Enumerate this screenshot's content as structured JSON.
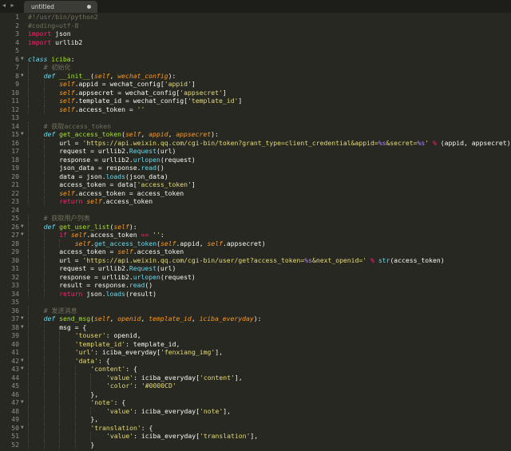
{
  "tabbar": {
    "nav_glyph": "◂ ▸",
    "tab_title": "untitled"
  },
  "lines": [
    {
      "n": "1",
      "fold": "",
      "indent": 0,
      "tokens": [
        [
          "cmt",
          "#!/usr/bin/python2"
        ]
      ]
    },
    {
      "n": "2",
      "fold": "",
      "indent": 0,
      "tokens": [
        [
          "cmt",
          "#coding=utf-8"
        ]
      ]
    },
    {
      "n": "3",
      "fold": "",
      "indent": 0,
      "tokens": [
        [
          "kw",
          "import"
        ],
        [
          "txt",
          " json"
        ]
      ]
    },
    {
      "n": "4",
      "fold": "",
      "indent": 0,
      "tokens": [
        [
          "kw",
          "import"
        ],
        [
          "txt",
          " urllib2"
        ]
      ]
    },
    {
      "n": "5",
      "fold": "",
      "indent": 0,
      "tokens": []
    },
    {
      "n": "6",
      "fold": "▼",
      "indent": 0,
      "tokens": [
        [
          "def",
          "class"
        ],
        [
          "txt",
          " "
        ],
        [
          "fn",
          "iciba"
        ],
        [
          "txt",
          ":"
        ]
      ]
    },
    {
      "n": "7",
      "fold": "",
      "indent": 1,
      "tokens": [
        [
          "cmt",
          "# 初始化"
        ]
      ]
    },
    {
      "n": "8",
      "fold": "▼",
      "indent": 1,
      "tokens": [
        [
          "def",
          "def"
        ],
        [
          "txt",
          " "
        ],
        [
          "fn",
          "__init__"
        ],
        [
          "txt",
          "("
        ],
        [
          "self",
          "self"
        ],
        [
          "txt",
          ", "
        ],
        [
          "self",
          "wechat_config"
        ],
        [
          "txt",
          "):"
        ]
      ]
    },
    {
      "n": "9",
      "fold": "",
      "indent": 2,
      "tokens": [
        [
          "self",
          "self"
        ],
        [
          "txt",
          ".appid = wechat_config["
        ],
        [
          "str",
          "'appid'"
        ],
        [
          "txt",
          "]"
        ]
      ]
    },
    {
      "n": "10",
      "fold": "",
      "indent": 2,
      "tokens": [
        [
          "self",
          "self"
        ],
        [
          "txt",
          ".appsecret = wechat_config["
        ],
        [
          "str",
          "'appsecret'"
        ],
        [
          "txt",
          "]"
        ]
      ]
    },
    {
      "n": "11",
      "fold": "",
      "indent": 2,
      "tokens": [
        [
          "self",
          "self"
        ],
        [
          "txt",
          ".template_id = wechat_config["
        ],
        [
          "str",
          "'template_id'"
        ],
        [
          "txt",
          "]"
        ]
      ]
    },
    {
      "n": "12",
      "fold": "",
      "indent": 2,
      "tokens": [
        [
          "self",
          "self"
        ],
        [
          "txt",
          ".access_token = "
        ],
        [
          "str",
          "''"
        ]
      ]
    },
    {
      "n": "13",
      "fold": "",
      "indent": 0,
      "tokens": []
    },
    {
      "n": "14",
      "fold": "",
      "indent": 1,
      "tokens": [
        [
          "cmt",
          "# 获取access_token"
        ]
      ]
    },
    {
      "n": "15",
      "fold": "▼",
      "indent": 1,
      "tokens": [
        [
          "def",
          "def"
        ],
        [
          "txt",
          " "
        ],
        [
          "fn",
          "get_access_token"
        ],
        [
          "txt",
          "("
        ],
        [
          "self",
          "self"
        ],
        [
          "txt",
          ", "
        ],
        [
          "self",
          "appid"
        ],
        [
          "txt",
          ", "
        ],
        [
          "self",
          "appsecret"
        ],
        [
          "txt",
          "):"
        ]
      ]
    },
    {
      "n": "16",
      "fold": "",
      "indent": 2,
      "tokens": [
        [
          "txt",
          "url = "
        ],
        [
          "str",
          "'https://api.weixin.qq.com/cgi-bin/token?grant_type=client_credential&appid="
        ],
        [
          "fmt",
          "%s"
        ],
        [
          "str",
          "&secret="
        ],
        [
          "fmt",
          "%s"
        ],
        [
          "str",
          "'"
        ],
        [
          "txt",
          " "
        ],
        [
          "kw",
          "%"
        ],
        [
          "txt",
          " (appid, appsecret)"
        ]
      ]
    },
    {
      "n": "17",
      "fold": "",
      "indent": 2,
      "tokens": [
        [
          "txt",
          "request = urllib2."
        ],
        [
          "bi",
          "Request"
        ],
        [
          "txt",
          "(url)"
        ]
      ]
    },
    {
      "n": "18",
      "fold": "",
      "indent": 2,
      "tokens": [
        [
          "txt",
          "response = urllib2."
        ],
        [
          "bi",
          "urlopen"
        ],
        [
          "txt",
          "(request)"
        ]
      ]
    },
    {
      "n": "19",
      "fold": "",
      "indent": 2,
      "tokens": [
        [
          "txt",
          "json_data = response."
        ],
        [
          "bi",
          "read"
        ],
        [
          "txt",
          "()"
        ]
      ]
    },
    {
      "n": "20",
      "fold": "",
      "indent": 2,
      "tokens": [
        [
          "txt",
          "data = json."
        ],
        [
          "bi",
          "loads"
        ],
        [
          "txt",
          "(json_data)"
        ]
      ]
    },
    {
      "n": "21",
      "fold": "",
      "indent": 2,
      "tokens": [
        [
          "txt",
          "access_token = data["
        ],
        [
          "str",
          "'access_token'"
        ],
        [
          "txt",
          "]"
        ]
      ]
    },
    {
      "n": "22",
      "fold": "",
      "indent": 2,
      "tokens": [
        [
          "self",
          "self"
        ],
        [
          "txt",
          ".access_token = access_token"
        ]
      ]
    },
    {
      "n": "23",
      "fold": "",
      "indent": 2,
      "tokens": [
        [
          "kw",
          "return"
        ],
        [
          "txt",
          " "
        ],
        [
          "self",
          "self"
        ],
        [
          "txt",
          ".access_token"
        ]
      ]
    },
    {
      "n": "24",
      "fold": "",
      "indent": 0,
      "tokens": []
    },
    {
      "n": "25",
      "fold": "",
      "indent": 1,
      "tokens": [
        [
          "cmt",
          "# 获取用户列表"
        ]
      ]
    },
    {
      "n": "26",
      "fold": "▼",
      "indent": 1,
      "tokens": [
        [
          "def",
          "def"
        ],
        [
          "txt",
          " "
        ],
        [
          "fn",
          "get_user_list"
        ],
        [
          "txt",
          "("
        ],
        [
          "self",
          "self"
        ],
        [
          "txt",
          "):"
        ]
      ]
    },
    {
      "n": "27",
      "fold": "▼",
      "indent": 2,
      "tokens": [
        [
          "kw",
          "if"
        ],
        [
          "txt",
          " "
        ],
        [
          "self",
          "self"
        ],
        [
          "txt",
          ".access_token "
        ],
        [
          "kw",
          "=="
        ],
        [
          "txt",
          " "
        ],
        [
          "str",
          "''"
        ],
        [
          "txt",
          ":"
        ]
      ]
    },
    {
      "n": "28",
      "fold": "",
      "indent": 3,
      "tokens": [
        [
          "self",
          "self"
        ],
        [
          "txt",
          "."
        ],
        [
          "bi",
          "get_access_token"
        ],
        [
          "txt",
          "("
        ],
        [
          "self",
          "self"
        ],
        [
          "txt",
          ".appid, "
        ],
        [
          "self",
          "self"
        ],
        [
          "txt",
          ".appsecret)"
        ]
      ]
    },
    {
      "n": "29",
      "fold": "",
      "indent": 2,
      "tokens": [
        [
          "txt",
          "access_token = "
        ],
        [
          "self",
          "self"
        ],
        [
          "txt",
          ".access_token"
        ]
      ]
    },
    {
      "n": "30",
      "fold": "",
      "indent": 2,
      "tokens": [
        [
          "txt",
          "url = "
        ],
        [
          "str",
          "'https://api.weixin.qq.com/cgi-bin/user/get?access_token="
        ],
        [
          "fmt",
          "%s"
        ],
        [
          "str",
          "&next_openid='"
        ],
        [
          "txt",
          " "
        ],
        [
          "kw",
          "%"
        ],
        [
          "txt",
          " "
        ],
        [
          "bi",
          "str"
        ],
        [
          "txt",
          "(access_token)"
        ]
      ]
    },
    {
      "n": "31",
      "fold": "",
      "indent": 2,
      "tokens": [
        [
          "txt",
          "request = urllib2."
        ],
        [
          "bi",
          "Request"
        ],
        [
          "txt",
          "(url)"
        ]
      ]
    },
    {
      "n": "32",
      "fold": "",
      "indent": 2,
      "tokens": [
        [
          "txt",
          "response = urllib2."
        ],
        [
          "bi",
          "urlopen"
        ],
        [
          "txt",
          "(request)"
        ]
      ]
    },
    {
      "n": "33",
      "fold": "",
      "indent": 2,
      "tokens": [
        [
          "txt",
          "result = response."
        ],
        [
          "bi",
          "read"
        ],
        [
          "txt",
          "()"
        ]
      ]
    },
    {
      "n": "34",
      "fold": "",
      "indent": 2,
      "tokens": [
        [
          "kw",
          "return"
        ],
        [
          "txt",
          " json."
        ],
        [
          "bi",
          "loads"
        ],
        [
          "txt",
          "(result)"
        ]
      ]
    },
    {
      "n": "35",
      "fold": "",
      "indent": 0,
      "tokens": []
    },
    {
      "n": "36",
      "fold": "",
      "indent": 1,
      "tokens": [
        [
          "cmt",
          "# 发送消息"
        ]
      ]
    },
    {
      "n": "37",
      "fold": "▼",
      "indent": 1,
      "tokens": [
        [
          "def",
          "def"
        ],
        [
          "txt",
          " "
        ],
        [
          "fn",
          "send_msg"
        ],
        [
          "txt",
          "("
        ],
        [
          "self",
          "self"
        ],
        [
          "txt",
          ", "
        ],
        [
          "self",
          "openid"
        ],
        [
          "txt",
          ", "
        ],
        [
          "self",
          "template_id"
        ],
        [
          "txt",
          ", "
        ],
        [
          "self",
          "iciba_everyday"
        ],
        [
          "txt",
          "):"
        ]
      ]
    },
    {
      "n": "38",
      "fold": "▼",
      "indent": 2,
      "tokens": [
        [
          "txt",
          "msg = {"
        ]
      ]
    },
    {
      "n": "39",
      "fold": "",
      "indent": 3,
      "tokens": [
        [
          "str",
          "'touser'"
        ],
        [
          "txt",
          ": openid,"
        ]
      ]
    },
    {
      "n": "40",
      "fold": "",
      "indent": 3,
      "tokens": [
        [
          "str",
          "'template_id'"
        ],
        [
          "txt",
          ": template_id,"
        ]
      ]
    },
    {
      "n": "41",
      "fold": "",
      "indent": 3,
      "tokens": [
        [
          "str",
          "'url'"
        ],
        [
          "txt",
          ": iciba_everyday["
        ],
        [
          "str",
          "'fenxiang_img'"
        ],
        [
          "txt",
          "],"
        ]
      ]
    },
    {
      "n": "42",
      "fold": "▼",
      "indent": 3,
      "tokens": [
        [
          "str",
          "'data'"
        ],
        [
          "txt",
          ": {"
        ]
      ]
    },
    {
      "n": "43",
      "fold": "▼",
      "indent": 4,
      "tokens": [
        [
          "str",
          "'content'"
        ],
        [
          "txt",
          ": {"
        ]
      ]
    },
    {
      "n": "44",
      "fold": "",
      "indent": 5,
      "tokens": [
        [
          "str",
          "'value'"
        ],
        [
          "txt",
          ": iciba_everyday["
        ],
        [
          "str",
          "'content'"
        ],
        [
          "txt",
          "],"
        ]
      ]
    },
    {
      "n": "45",
      "fold": "",
      "indent": 5,
      "tokens": [
        [
          "str",
          "'color'"
        ],
        [
          "txt",
          ": "
        ],
        [
          "str",
          "'#0000CD'"
        ]
      ]
    },
    {
      "n": "46",
      "fold": "",
      "indent": 4,
      "tokens": [
        [
          "txt",
          "},"
        ]
      ]
    },
    {
      "n": "47",
      "fold": "▼",
      "indent": 4,
      "tokens": [
        [
          "str",
          "'note'"
        ],
        [
          "txt",
          ": {"
        ]
      ]
    },
    {
      "n": "48",
      "fold": "",
      "indent": 5,
      "tokens": [
        [
          "str",
          "'value'"
        ],
        [
          "txt",
          ": iciba_everyday["
        ],
        [
          "str",
          "'note'"
        ],
        [
          "txt",
          "],"
        ]
      ]
    },
    {
      "n": "49",
      "fold": "",
      "indent": 4,
      "tokens": [
        [
          "txt",
          "},"
        ]
      ]
    },
    {
      "n": "50",
      "fold": "▼",
      "indent": 4,
      "tokens": [
        [
          "str",
          "'translation'"
        ],
        [
          "txt",
          ": {"
        ]
      ]
    },
    {
      "n": "51",
      "fold": "",
      "indent": 5,
      "tokens": [
        [
          "str",
          "'value'"
        ],
        [
          "txt",
          ": iciba_everyday["
        ],
        [
          "str",
          "'translation'"
        ],
        [
          "txt",
          "],"
        ]
      ]
    },
    {
      "n": "52",
      "fold": "",
      "indent": 4,
      "tokens": [
        [
          "txt",
          "}"
        ]
      ]
    }
  ]
}
